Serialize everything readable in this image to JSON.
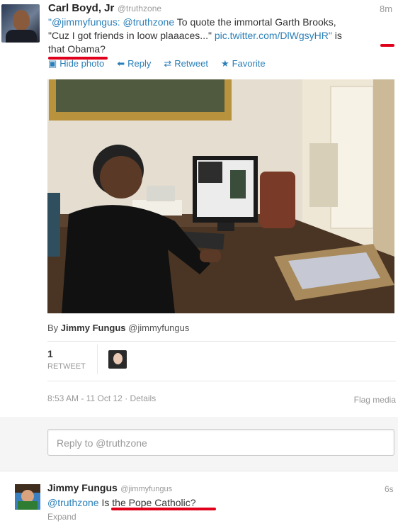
{
  "tweet": {
    "author_name": "Carl Boyd, Jr",
    "author_handle": "@truthzone",
    "time": "8m",
    "text_mention1": "\"@jimmyfungus:",
    "text_mention2": "@truthzone",
    "text_body1": "To quote the immortal Garth Brooks,",
    "text_body2": "\"Cuz I got friends in loow plaaaces...\"",
    "text_link": "pic.twitter.com/DlWgsyHR\"",
    "text_tail1": "is",
    "text_tail2": "that Obama?",
    "actions": {
      "hide_photo": "Hide photo",
      "reply": "Reply",
      "retweet": "Retweet",
      "favorite": "Favorite"
    }
  },
  "photo_credit": {
    "by": "By",
    "name": "Jimmy Fungus",
    "handle": "@jimmyfungus"
  },
  "stats": {
    "retweet_count": "1",
    "retweet_label": "RETWEET"
  },
  "meta": {
    "timestamp": "8:53 AM - 11 Oct 12",
    "details": "Details",
    "flag_media": "Flag media"
  },
  "reply_box": {
    "placeholder": "Reply to @truthzone"
  },
  "reply_tweet": {
    "author_name": "Jimmy Fungus",
    "author_handle": "@jimmyfungus",
    "time": "6s",
    "mention": "@truthzone",
    "text": "Is the Pope Catholic?",
    "expand": "Expand"
  },
  "colors": {
    "link": "#2a7fb8",
    "highlight_red": "#e0001b"
  }
}
